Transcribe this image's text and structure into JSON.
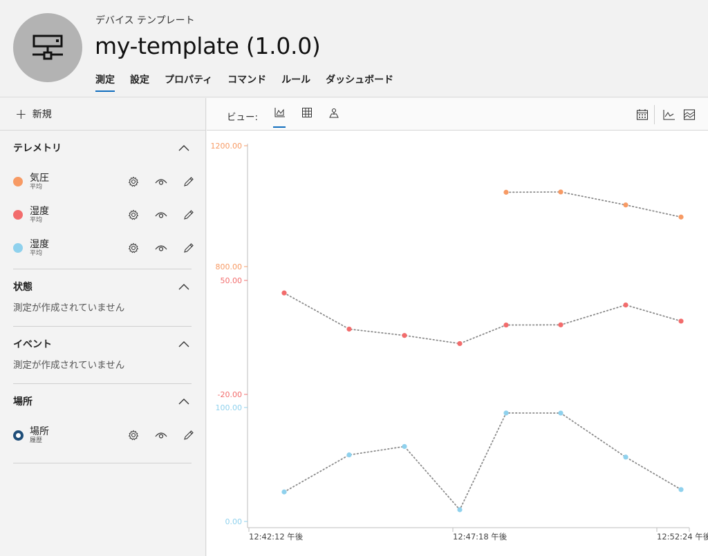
{
  "header": {
    "subtitle": "デバイス テンプレート",
    "title": "my-template (1.0.0)",
    "tabs": [
      {
        "label": "測定",
        "active": true
      },
      {
        "label": "設定"
      },
      {
        "label": "プロパティ"
      },
      {
        "label": "コマンド"
      },
      {
        "label": "ルール"
      },
      {
        "label": "ダッシュボード"
      }
    ],
    "avatar_icon": "device-icon"
  },
  "sidebar": {
    "new_label": "新規",
    "sections": {
      "telemetry": {
        "title": "テレメトリ",
        "items": [
          {
            "name": "気圧",
            "sub": "平均",
            "color": "#f79a64"
          },
          {
            "name": "湿度",
            "sub": "平均",
            "color": "#f26c6c"
          },
          {
            "name": "湿度",
            "sub": "平均",
            "color": "#8fd1ed"
          }
        ]
      },
      "state": {
        "title": "状態",
        "empty": "測定が作成されていません"
      },
      "event": {
        "title": "イベント",
        "empty": "測定が作成されていません"
      },
      "location": {
        "title": "場所",
        "items": [
          {
            "name": "場所",
            "sub": "履歴",
            "color": "#1f4e79"
          }
        ]
      }
    }
  },
  "main": {
    "view_label": "ビュー:",
    "view_icons": [
      "line-chart-icon",
      "grid-icon",
      "map-pin-icon"
    ],
    "right_icons": [
      "calendar-icon",
      "line-chart-icon",
      "area-chart-icon"
    ]
  },
  "chart_data": {
    "type": "line",
    "x": [
      "12:42:12 午後",
      "12:47:18 午後",
      "12:52:24 午後"
    ],
    "x_ticks": [
      "12:42:12 午後",
      "12:47:18 午後",
      "12:52:24 午後"
    ],
    "series": [
      {
        "name": "気圧",
        "color": "#f79a64",
        "axis_ticks": [
          "1200.00",
          "800.00"
        ],
        "axis_range": [
          800,
          1200
        ],
        "points": [
          [
            4,
            1046
          ],
          [
            5,
            1047
          ],
          [
            6,
            1004
          ],
          [
            7,
            964
          ]
        ]
      },
      {
        "name": "湿度",
        "color": "#f26c6c",
        "axis_ticks": [
          "50.00",
          "-20.00"
        ],
        "axis_range": [
          -20,
          50
        ],
        "points": [
          [
            0,
            42.3
          ],
          [
            1,
            20.1
          ],
          [
            2,
            16.2
          ],
          [
            3,
            11.2
          ],
          [
            4,
            22.6
          ],
          [
            5,
            22.7
          ],
          [
            6,
            34.9
          ],
          [
            7,
            25.0
          ]
        ]
      },
      {
        "name": "湿度",
        "color": "#8fd1ed",
        "axis_ticks": [
          "100.00",
          "0.00"
        ],
        "axis_range": [
          0,
          100
        ],
        "points": [
          [
            0,
            25.9
          ],
          [
            1,
            58.4
          ],
          [
            2,
            65.8
          ],
          [
            3,
            10.3
          ],
          [
            4,
            95.2
          ],
          [
            5,
            95.1
          ],
          [
            6,
            56.5
          ],
          [
            7,
            28.0
          ]
        ]
      }
    ],
    "line_style": "dotted",
    "line_color": "#8a8a8a"
  }
}
